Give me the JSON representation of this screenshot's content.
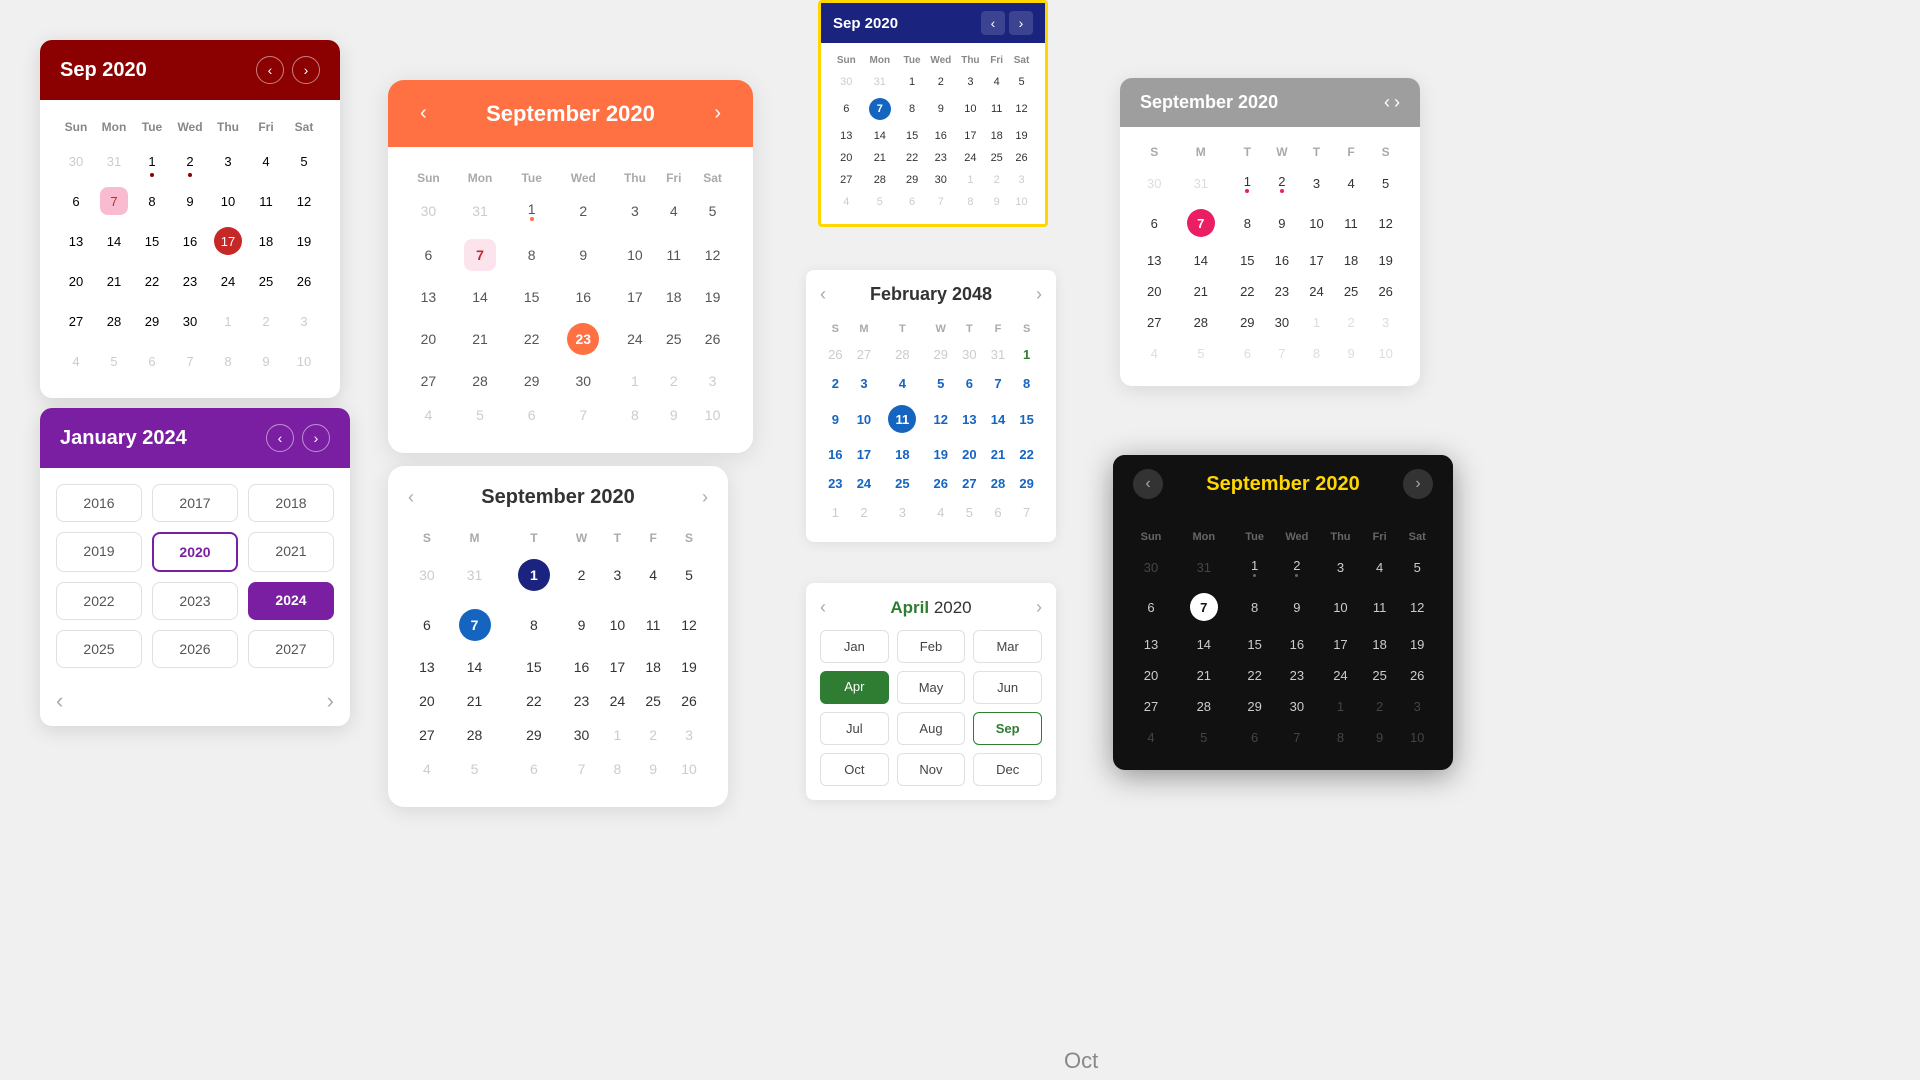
{
  "cal1": {
    "title": "Sep 2020",
    "days_header": [
      "Sun",
      "Mon",
      "Tue",
      "Wed",
      "Thu",
      "Fri",
      "Sat"
    ],
    "weeks": [
      [
        "30",
        "31",
        "1",
        "2",
        "3",
        "4",
        "5"
      ],
      [
        "6",
        "7",
        "8",
        "9",
        "10",
        "11",
        "12"
      ],
      [
        "13",
        "14",
        "15",
        "16",
        "17",
        "18",
        "19"
      ],
      [
        "20",
        "21",
        "22",
        "23",
        "24",
        "25",
        "26"
      ],
      [
        "27",
        "28",
        "29",
        "30",
        "1",
        "2",
        "3"
      ],
      [
        "4",
        "5",
        "6",
        "7",
        "8",
        "9",
        "10"
      ]
    ],
    "selected": "17",
    "event_dots": [
      "1",
      "2"
    ],
    "other_start": [
      "30",
      "31"
    ],
    "other_end": [
      "1",
      "2",
      "3",
      "4",
      "5",
      "6",
      "7",
      "8",
      "9",
      "10"
    ],
    "highlighted7": "7"
  },
  "cal2": {
    "title": "September 2020",
    "days_header": [
      "Sun",
      "Mon",
      "Tue",
      "Wed",
      "Thu",
      "Fri",
      "Sat"
    ],
    "weeks": [
      [
        "30",
        "31",
        "1",
        "2",
        "3",
        "4",
        "5"
      ],
      [
        "6",
        "7",
        "8",
        "9",
        "10",
        "11",
        "12"
      ],
      [
        "13",
        "14",
        "15",
        "16",
        "17",
        "18",
        "19"
      ],
      [
        "20",
        "21",
        "22",
        "23",
        "24",
        "25",
        "26"
      ],
      [
        "27",
        "28",
        "29",
        "30",
        "1",
        "2",
        "3"
      ],
      [
        "4",
        "5",
        "6",
        "7",
        "8",
        "9",
        "10"
      ]
    ],
    "selected": "23",
    "event_dot": "1",
    "highlighted7": "7"
  },
  "cal3": {
    "title": "January 2024",
    "years": [
      "2016",
      "2017",
      "2018",
      "2019",
      "2020",
      "2021",
      "2022",
      "2023",
      "2024",
      "2025",
      "2026",
      "2027"
    ],
    "selected_outline": "2020",
    "selected_fill": "2024"
  },
  "cal4": {
    "title": "September 2020",
    "days_header": [
      "S",
      "M",
      "T",
      "W",
      "T",
      "F",
      "S"
    ],
    "weeks": [
      [
        "30",
        "31",
        "1",
        "2",
        "3",
        "4",
        "5"
      ],
      [
        "6",
        "7",
        "8",
        "9",
        "10",
        "11",
        "12"
      ],
      [
        "13",
        "14",
        "15",
        "16",
        "17",
        "18",
        "19"
      ],
      [
        "20",
        "21",
        "22",
        "23",
        "24",
        "25",
        "26"
      ],
      [
        "27",
        "28",
        "29",
        "30",
        "1",
        "2",
        "3"
      ],
      [
        "4",
        "5",
        "6",
        "7",
        "8",
        "9",
        "10"
      ]
    ],
    "selected": "1",
    "highlighted7": "7"
  },
  "cal5": {
    "title": "Sep 2020",
    "days_header": [
      "Sun",
      "Mon",
      "Tue",
      "Wed",
      "Thu",
      "Fri",
      "Sat"
    ],
    "weeks": [
      [
        "30",
        "31",
        "1",
        "2",
        "3",
        "4",
        "5"
      ],
      [
        "6",
        "7",
        "8",
        "9",
        "10",
        "11",
        "12"
      ],
      [
        "13",
        "14",
        "15",
        "16",
        "17",
        "18",
        "19"
      ],
      [
        "20",
        "21",
        "22",
        "23",
        "24",
        "25",
        "26"
      ],
      [
        "27",
        "28",
        "29",
        "30",
        "1",
        "2",
        "3"
      ],
      [
        "4",
        "5",
        "6",
        "7",
        "8",
        "9",
        "10"
      ]
    ],
    "selected": "7"
  },
  "cal6": {
    "title": "February 2048",
    "days_header": [
      "S",
      "M",
      "T",
      "W",
      "T",
      "F",
      "S"
    ],
    "weeks": [
      [
        "26",
        "27",
        "28",
        "29",
        "30",
        "31",
        "1"
      ],
      [
        "2",
        "3",
        "4",
        "5",
        "6",
        "7",
        "8"
      ],
      [
        "9",
        "10",
        "11",
        "12",
        "13",
        "14",
        "15"
      ],
      [
        "16",
        "17",
        "18",
        "19",
        "20",
        "21",
        "22"
      ],
      [
        "23",
        "24",
        "25",
        "26",
        "27",
        "28",
        "29"
      ],
      [
        "1",
        "2",
        "3",
        "4",
        "5",
        "6",
        "7"
      ]
    ],
    "selected": "11",
    "other_start_count": 6,
    "other_end_count": 7
  },
  "cal7": {
    "title": "April 2020",
    "months": [
      "Jan",
      "Feb",
      "Mar",
      "Apr",
      "May",
      "Jun",
      "Jul",
      "Aug",
      "Sep",
      "Oct",
      "Nov",
      "Dec"
    ],
    "selected_fill": "Apr",
    "selected_outline": "Sep"
  },
  "cal8": {
    "title": "September 2020",
    "days_header": [
      "S",
      "M",
      "T",
      "W",
      "T",
      "F",
      "S"
    ],
    "weeks": [
      [
        "30",
        "31",
        "1",
        "2",
        "3",
        "4",
        "5"
      ],
      [
        "6",
        "7",
        "8",
        "9",
        "10",
        "11",
        "12"
      ],
      [
        "13",
        "14",
        "15",
        "16",
        "17",
        "18",
        "19"
      ],
      [
        "20",
        "21",
        "22",
        "23",
        "24",
        "25",
        "26"
      ],
      [
        "27",
        "28",
        "29",
        "30",
        "1",
        "2",
        "3"
      ],
      [
        "4",
        "5",
        "6",
        "7",
        "8",
        "9",
        "10"
      ]
    ],
    "selected7": "7",
    "event_dots": [
      "1",
      "2"
    ]
  },
  "cal9": {
    "title": "September 2020",
    "days_header": [
      "Sun",
      "Mon",
      "Tue",
      "Wed",
      "Thu",
      "Fri",
      "Sat"
    ],
    "weeks": [
      [
        "30",
        "31",
        "1",
        "2",
        "3",
        "4",
        "5"
      ],
      [
        "6",
        "7",
        "8",
        "9",
        "10",
        "11",
        "12"
      ],
      [
        "13",
        "14",
        "15",
        "16",
        "17",
        "18",
        "19"
      ],
      [
        "20",
        "21",
        "22",
        "23",
        "24",
        "25",
        "26"
      ],
      [
        "27",
        "28",
        "29",
        "30",
        "1",
        "2",
        "3"
      ],
      [
        "4",
        "5",
        "6",
        "7",
        "8",
        "9",
        "10"
      ]
    ],
    "selected": "7",
    "event_dots": [
      "1",
      "2"
    ]
  },
  "bottom_label": "Oct"
}
